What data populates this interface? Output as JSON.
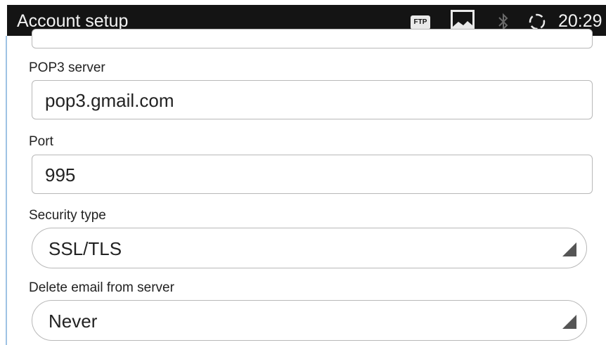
{
  "status_bar": {
    "title": "Account setup",
    "ftp_badge": "FTP",
    "icons": [
      "ftp-icon",
      "image-icon",
      "bluetooth-icon",
      "sync-icon"
    ],
    "time": "20:29"
  },
  "form": {
    "pop3_server": {
      "label": "POP3 server",
      "value": "pop3.gmail.com"
    },
    "port": {
      "label": "Port",
      "value": "995"
    },
    "security_type": {
      "label": "Security type",
      "value": "SSL/TLS"
    },
    "delete_email": {
      "label": "Delete email from server",
      "value": "Never"
    }
  }
}
